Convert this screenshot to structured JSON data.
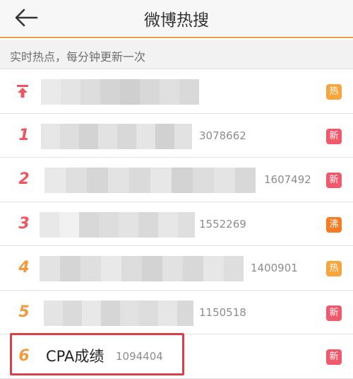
{
  "header": {
    "title": "微博热搜",
    "back_icon": "back-arrow-icon"
  },
  "subheader": {
    "text": "实时热点，每分钟更新一次"
  },
  "colors": {
    "accent": "#f0a04b",
    "rank_red": "#f1545d",
    "rank_orange": "#f39a3a",
    "badge_hot": "#f7a43a",
    "badge_new": "#f0586c",
    "badge_boil": "#f57b24",
    "highlight": "#d9414a"
  },
  "rows": [
    {
      "rank": "",
      "pinned": true,
      "topic": "",
      "count": "",
      "badge": "热",
      "badge_color": "#f7a43a",
      "rank_color": "#f1545d"
    },
    {
      "rank": "1",
      "pinned": false,
      "topic": "",
      "count": "3078662",
      "badge": "新",
      "badge_color": "#f0586c",
      "rank_color": "#f1545d"
    },
    {
      "rank": "2",
      "pinned": false,
      "topic": "",
      "count": "1607492",
      "badge": "新",
      "badge_color": "#f0586c",
      "rank_color": "#f1545d"
    },
    {
      "rank": "3",
      "pinned": false,
      "topic": "",
      "count": "1552269",
      "badge": "沸",
      "badge_color": "#f57b24",
      "rank_color": "#f1545d"
    },
    {
      "rank": "4",
      "pinned": false,
      "topic": "",
      "count": "1400901",
      "badge": "热",
      "badge_color": "#f7a43a",
      "rank_color": "#f39a3a"
    },
    {
      "rank": "5",
      "pinned": false,
      "topic": "",
      "count": "1150518",
      "badge": "新",
      "badge_color": "#f0586c",
      "rank_color": "#f39a3a"
    },
    {
      "rank": "6",
      "pinned": false,
      "topic": "CPA成绩",
      "count": "1094404",
      "badge": "新",
      "badge_color": "#f0586c",
      "rank_color": "#f39a3a"
    }
  ]
}
